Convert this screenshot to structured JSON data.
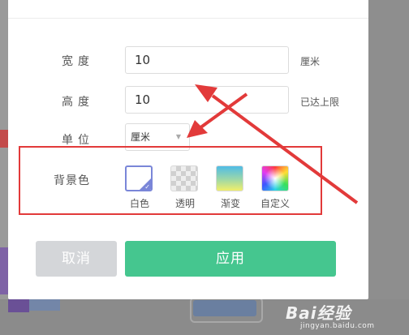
{
  "dialog": {
    "width": {
      "label": "宽度",
      "value": "10",
      "unit": "厘米"
    },
    "height": {
      "label": "高度",
      "value": "10",
      "unit": "已达上限"
    },
    "unit": {
      "label": "单位",
      "selected": "厘米"
    },
    "background": {
      "label": "背景色",
      "options": [
        {
          "label": "白色",
          "kind": "white",
          "selected": true
        },
        {
          "label": "透明",
          "kind": "transparent",
          "selected": false
        },
        {
          "label": "渐变",
          "kind": "gradient",
          "selected": false
        },
        {
          "label": "自定义",
          "kind": "custom",
          "selected": false
        }
      ]
    },
    "buttons": {
      "cancel": "取消",
      "apply": "应用"
    }
  },
  "colors": {
    "apply_button": "#45c68f",
    "cancel_button": "#d4d6d9",
    "annotation_red": "#e23a3a",
    "selected_swatch": "#7a86d8"
  },
  "watermark": {
    "logo": "Bai经验",
    "url": "jingyan.baidu.com"
  }
}
